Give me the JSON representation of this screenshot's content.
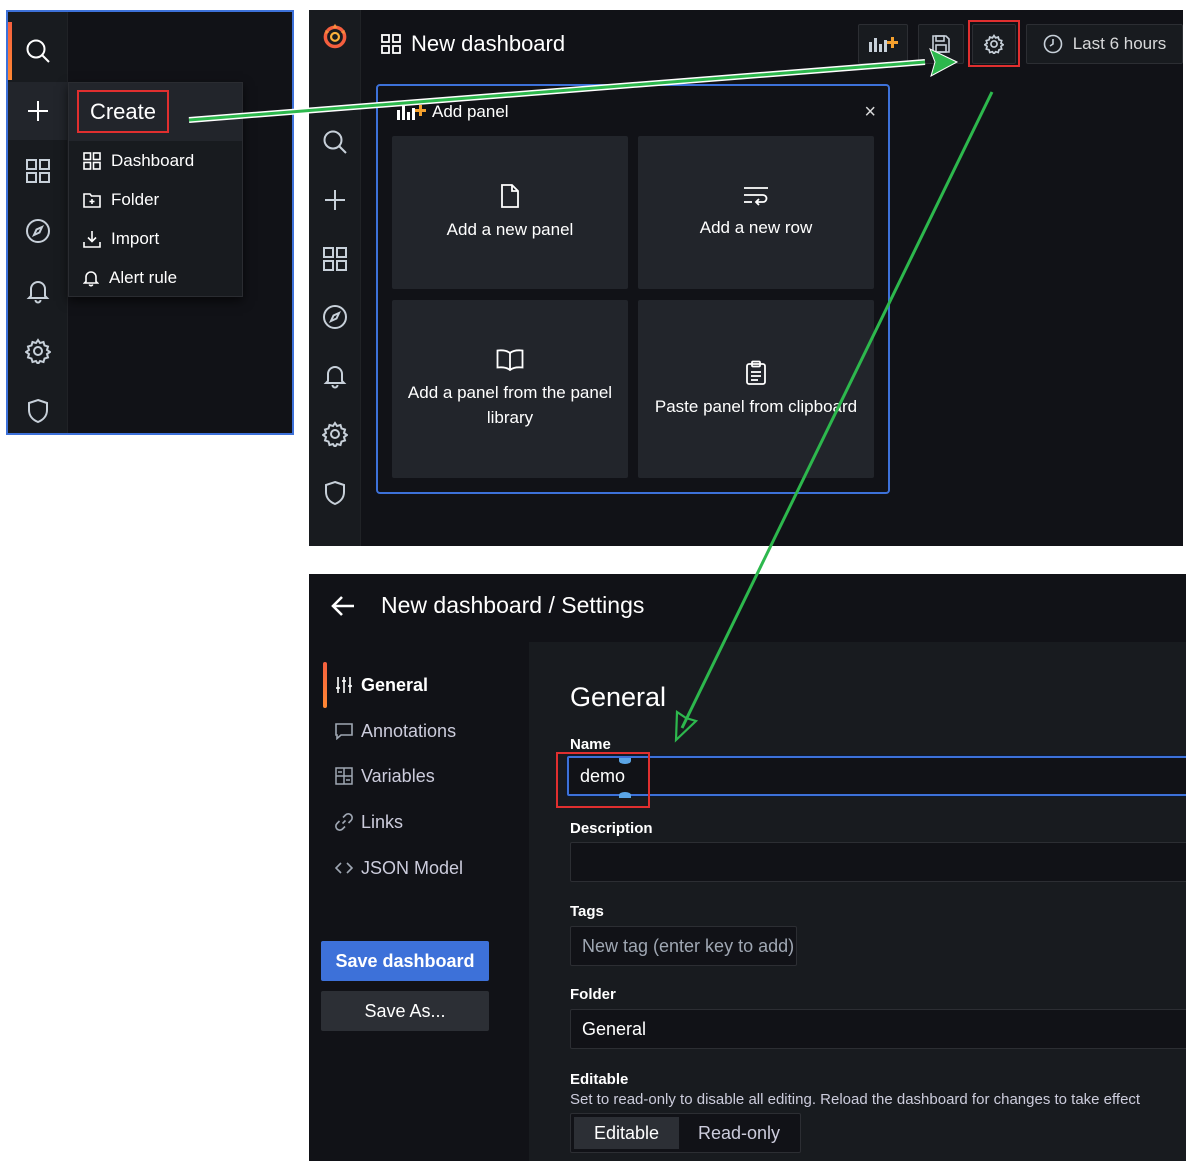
{
  "create_menu": {
    "title": "Create",
    "items": [
      {
        "label": "Dashboard",
        "icon": "apps-icon"
      },
      {
        "label": "Folder",
        "icon": "folder-plus-icon"
      },
      {
        "label": "Import",
        "icon": "import-icon"
      },
      {
        "label": "Alert rule",
        "icon": "bell-icon"
      }
    ]
  },
  "dashboard": {
    "title": "New dashboard",
    "time_range": "Last 6 hours",
    "add_panel": {
      "title": "Add panel",
      "close": "×",
      "tiles": [
        {
          "label": "Add a new panel",
          "icon": "file-blank-icon"
        },
        {
          "label": "Add a new row",
          "icon": "wrap-text-icon"
        },
        {
          "label": "Add a panel from the panel library",
          "icon": "book-open-icon"
        },
        {
          "label": "Paste panel from clipboard",
          "icon": "clipboard-icon"
        }
      ]
    }
  },
  "settings": {
    "breadcrumb": "New dashboard / Settings",
    "nav": [
      {
        "label": "General",
        "icon": "sliders-icon",
        "active": true
      },
      {
        "label": "Annotations",
        "icon": "comment-icon"
      },
      {
        "label": "Variables",
        "icon": "calculator-icon"
      },
      {
        "label": "Links",
        "icon": "link-icon"
      },
      {
        "label": "JSON Model",
        "icon": "code-icon"
      }
    ],
    "save_button": "Save dashboard",
    "save_as_button": "Save As...",
    "heading": "General",
    "name_label": "Name",
    "name_value": "demo",
    "description_label": "Description",
    "description_value": "",
    "tags_label": "Tags",
    "tags_placeholder": "New tag (enter key to add)",
    "folder_label": "Folder",
    "folder_value": "General",
    "editable_label": "Editable",
    "editable_hint": "Set to read-only to disable all editing. Reload the dashboard for changes to take effect",
    "editable_options": [
      "Editable",
      "Read-only"
    ],
    "editable_selected": "Editable"
  },
  "colors": {
    "accent_blue": "#3d71d9",
    "highlight_red": "#e02f2f",
    "arrow_green": "#2db84d",
    "grafana_orange": "#f55f3e",
    "bg_dark": "#111217",
    "panel_bg": "#181b1f"
  }
}
